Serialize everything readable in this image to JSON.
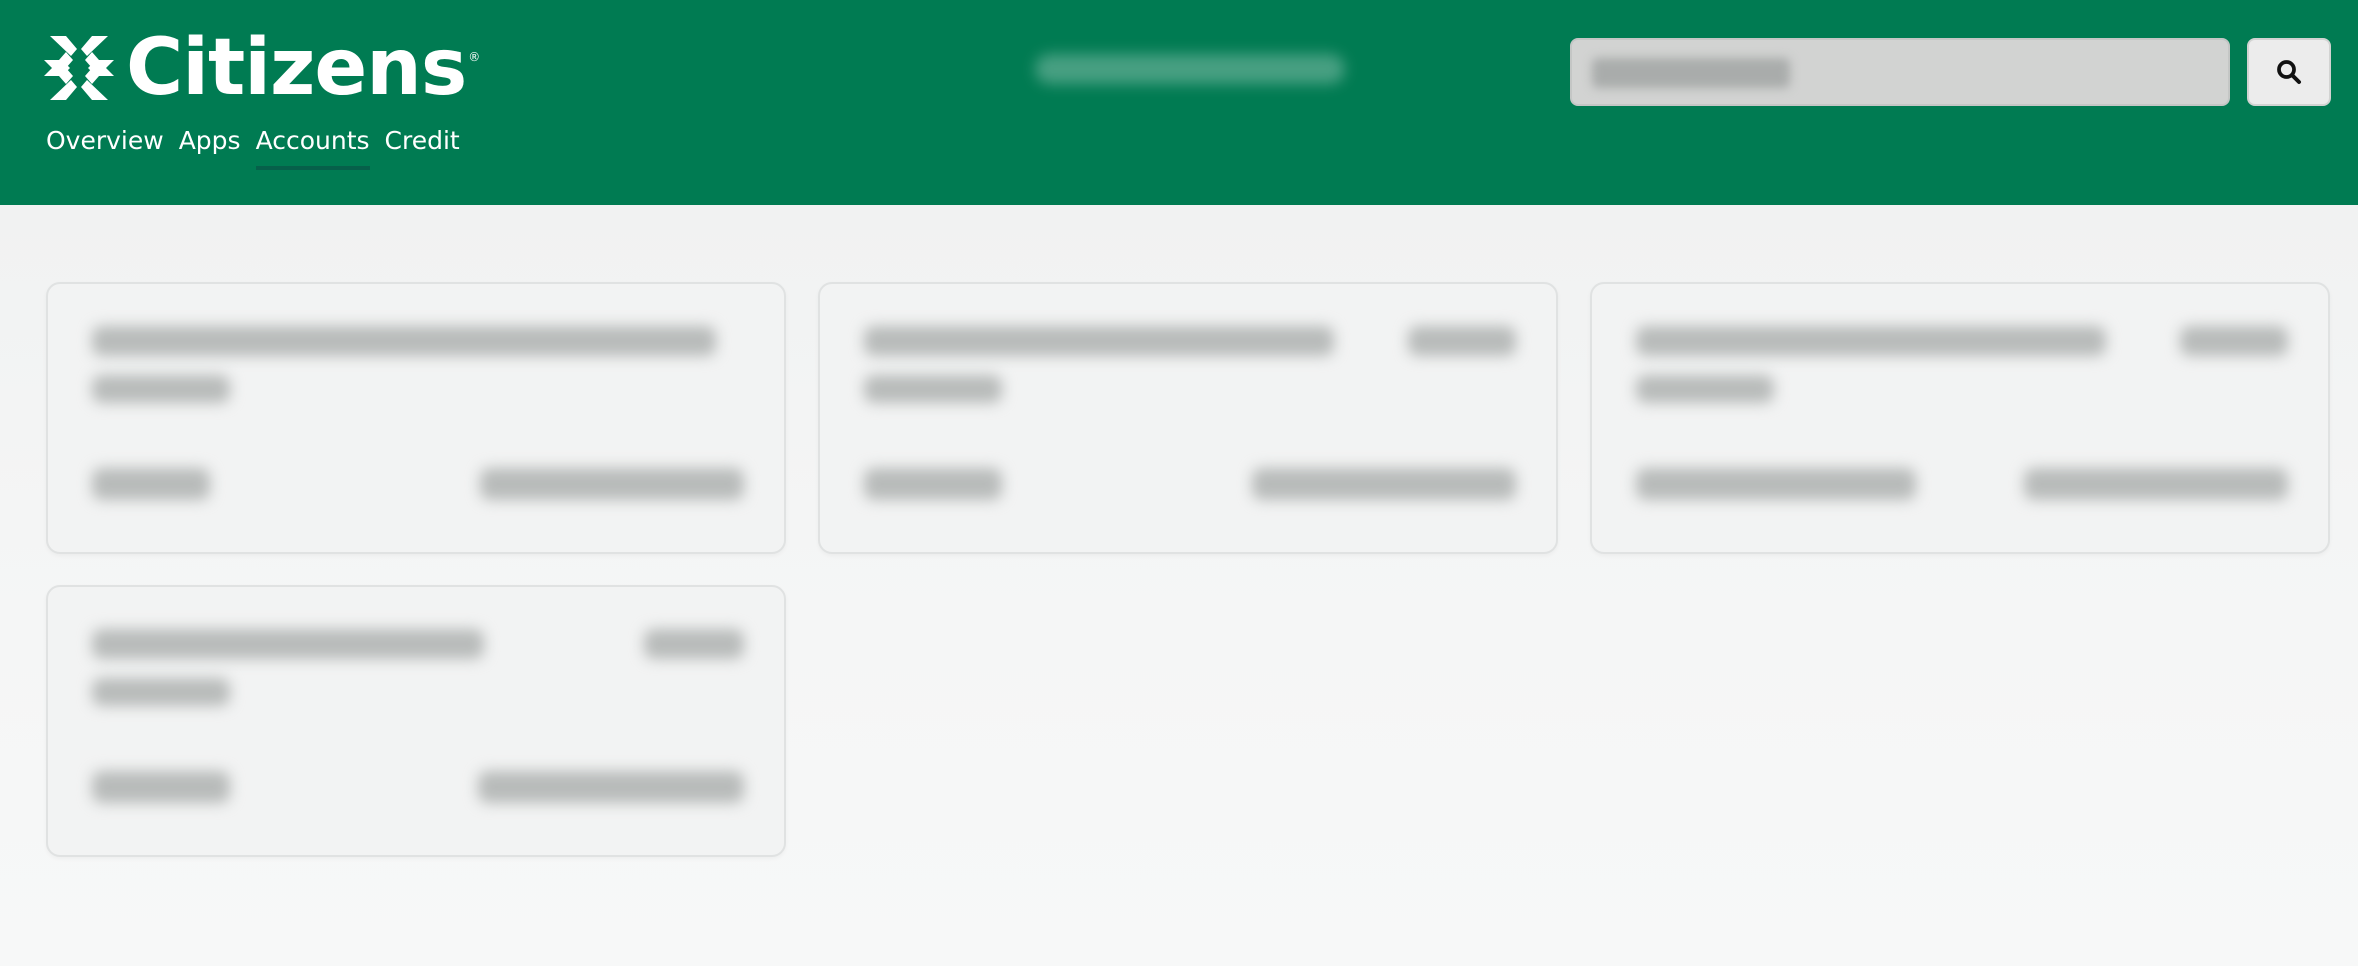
{
  "header": {
    "brand": {
      "name": "Citizens",
      "registered": "®",
      "logo_icon": "citizens-logo-icon",
      "color": "#007b52"
    },
    "nav": [
      {
        "label": "Overview",
        "active": false
      },
      {
        "label": "Apps",
        "active": false
      },
      {
        "label": "Accounts",
        "active": true
      },
      {
        "label": "Credit",
        "active": false
      }
    ],
    "search": {
      "value": "",
      "placeholder": "",
      "button_icon": "search-icon"
    }
  },
  "accounts": {
    "cards": [
      {
        "title": "",
        "subtitle": "",
        "amount": "",
        "account_number": "",
        "status": ""
      },
      {
        "title": "",
        "subtitle": "",
        "amount": "",
        "account_number": "",
        "status": ""
      },
      {
        "title": "",
        "subtitle": "",
        "amount": "",
        "account_number": "",
        "status": ""
      },
      {
        "title": "",
        "subtitle": "",
        "amount": "",
        "account_number": "",
        "status": ""
      }
    ]
  }
}
